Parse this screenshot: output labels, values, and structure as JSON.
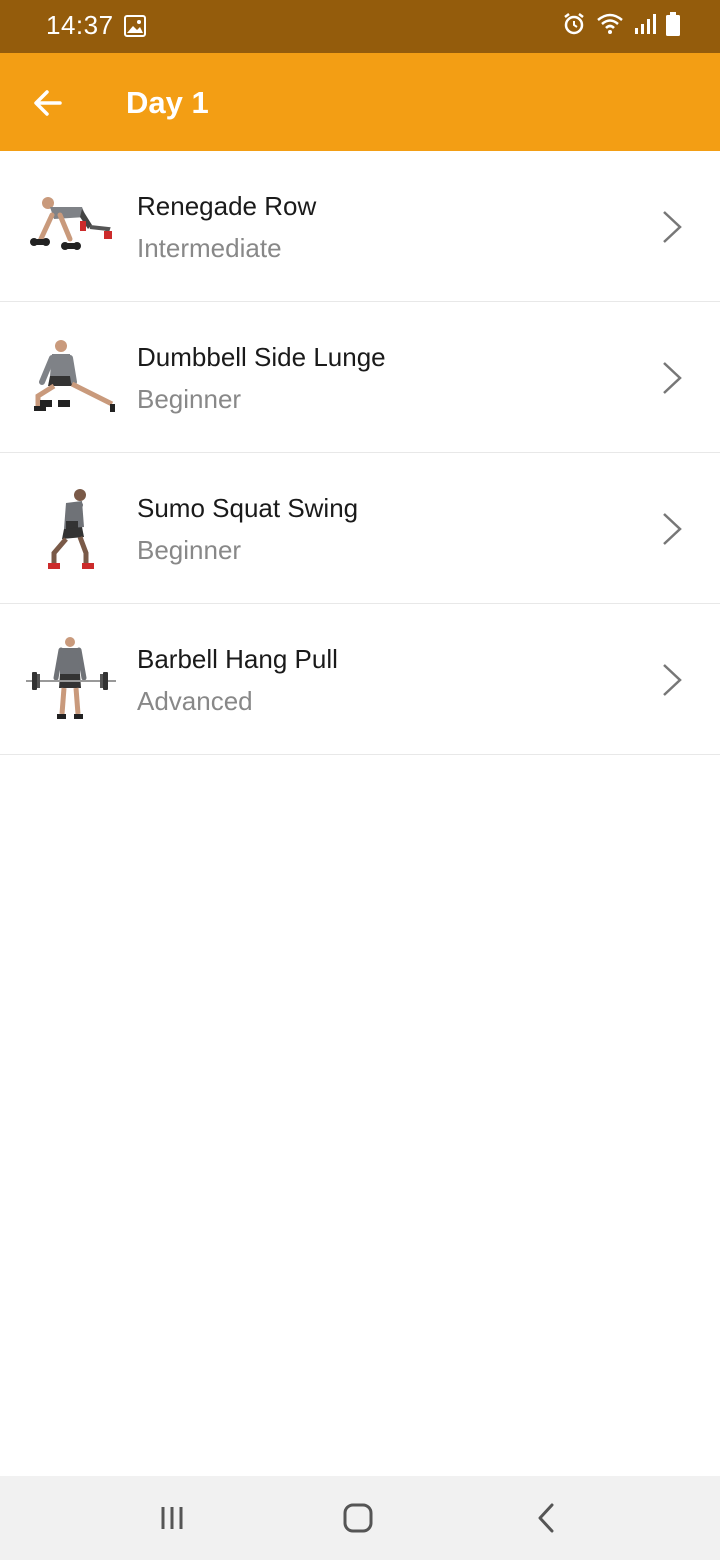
{
  "status_bar": {
    "time": "14:37",
    "icons": [
      "gallery-icon",
      "alarm-icon",
      "wifi-icon",
      "signal-icon",
      "battery-icon"
    ]
  },
  "app_bar": {
    "title": "Day 1",
    "back_icon": "arrow-left-icon",
    "background": "#f39e14"
  },
  "exercises": [
    {
      "name": "Renegade Row",
      "level": "Intermediate"
    },
    {
      "name": "Dumbbell Side Lunge",
      "level": "Beginner"
    },
    {
      "name": "Sumo Squat Swing",
      "level": "Beginner"
    },
    {
      "name": "Barbell Hang Pull",
      "level": "Advanced"
    }
  ],
  "nav_bar": {
    "icons": [
      "recents-icon",
      "home-icon",
      "back-icon"
    ]
  },
  "colors": {
    "status_bar": "#945c0c",
    "accent": "#f39e14",
    "subtitle": "#888888"
  }
}
